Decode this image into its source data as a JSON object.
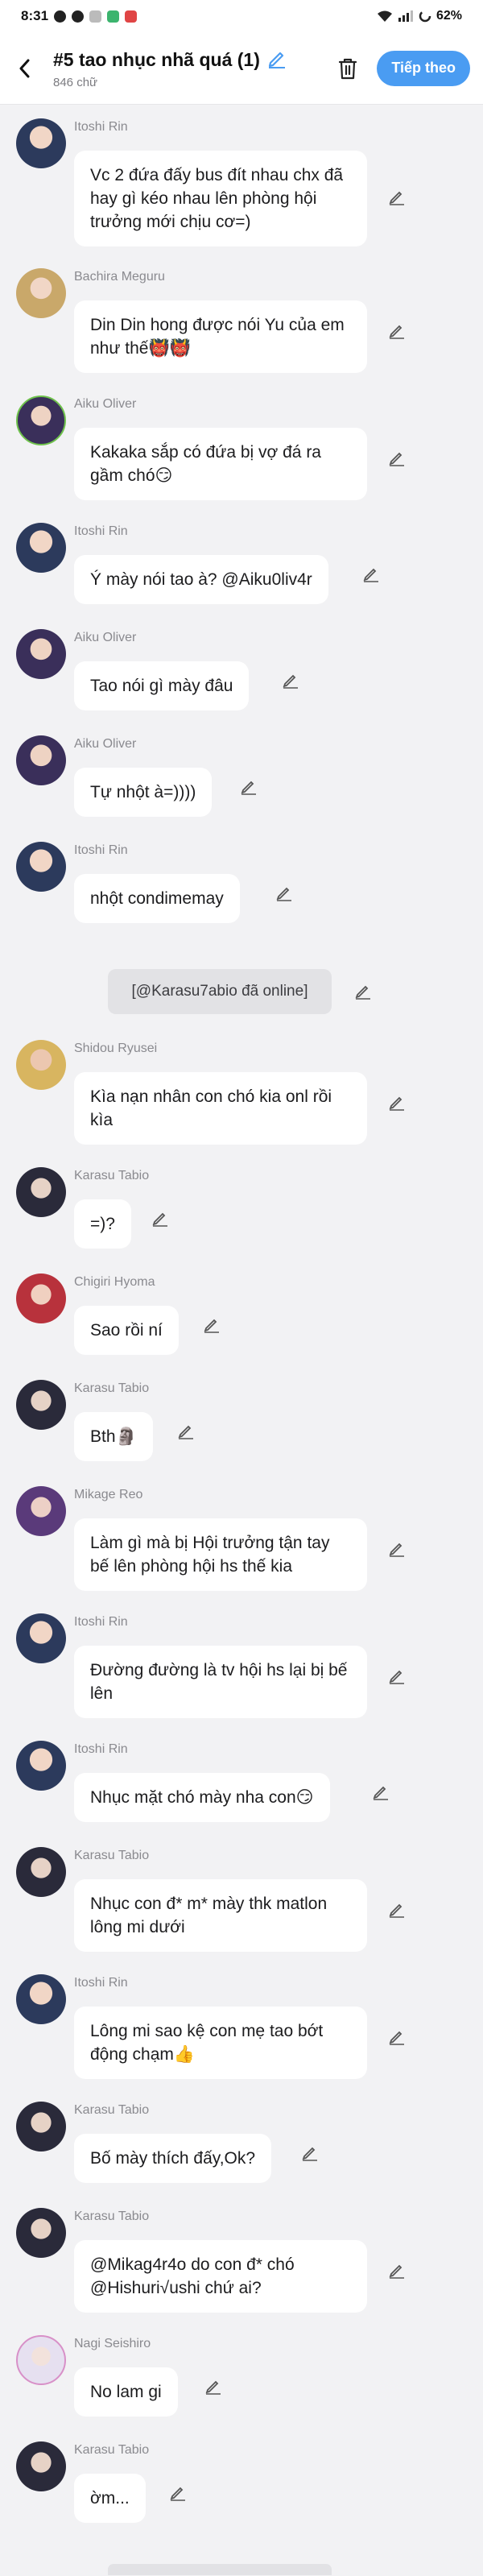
{
  "status": {
    "time": "8:31",
    "battery": "62%"
  },
  "header": {
    "title": "#5 tao nhục nhã quá (1)",
    "subtitle": "846 chữ",
    "follow_label": "Tiếp theo"
  },
  "system_message": "[@Karasu7abio đã online]",
  "messages": [
    {
      "name": "Itoshi Rin",
      "text": "Vc 2 đứa đấy bus đít nhau chx đã hay gì kéo nhau lên phòng hội trưởng mới chịu cơ=)"
    },
    {
      "name": "Bachira Meguru",
      "text": "Din Din hong được nói Yu của em như thế👹👹"
    },
    {
      "name": "Aiku Oliver",
      "text": "Kakaka sắp có đứa bị vợ đá ra gầm chó😏"
    },
    {
      "name": "Itoshi Rin",
      "text": "Ý mày nói tao à? @Aiku0liv4r"
    },
    {
      "name": "Aiku Oliver",
      "text": "Tao nói gì mày đâu"
    },
    {
      "name": "Aiku Oliver",
      "text": "Tự nhột à=))))"
    },
    {
      "name": "Itoshi Rin",
      "text": "nhột condimemay"
    },
    {
      "name": "Shidou Ryusei",
      "text": "Kìa nạn nhân con chó kia onl rồi kìa"
    },
    {
      "name": "Karasu Tabio",
      "text": "=)?"
    },
    {
      "name": "Chigiri Hyoma",
      "text": "Sao rồi ní"
    },
    {
      "name": "Karasu Tabio",
      "text": "Bth🗿"
    },
    {
      "name": "Mikage Reo",
      "text": "Làm gì mà bị Hội trưởng tận tay bế lên phòng hội hs thế kia"
    },
    {
      "name": "Itoshi Rin",
      "text": "Đường đường là tv hội hs lại bị bế lên"
    },
    {
      "name": "Itoshi Rin",
      "text": "Nhục mặt chó mày nha con😏"
    },
    {
      "name": "Karasu Tabio",
      "text": "Nhục con đ* m* mày thk matlon lông mi dưới"
    },
    {
      "name": "Itoshi Rin",
      "text": "Lông mi sao kệ con mẹ tao bớt động chạm👍"
    },
    {
      "name": "Karasu Tabio",
      "text": "Bố mày thích đấy,Ok?"
    },
    {
      "name": "Karasu Tabio",
      "text": "@Mikag4r4o do con đ* chó @Hishuri√ushi chứ ai?"
    },
    {
      "name": "Nagi Seishiro",
      "text": "No lam gi"
    },
    {
      "name": "Karasu Tabio",
      "text": "ờm..."
    }
  ],
  "colors": {
    "accent": "#4a9cf2",
    "background": "#f2f2f4",
    "bubble": "#ffffff",
    "avatar_itoshi": "#2c3a5c",
    "avatar_bachira": "#c9a86a",
    "avatar_aiku": "#3a2f5a",
    "avatar_shidou": "#d8b560",
    "avatar_karasu": "#2a2a3a",
    "avatar_chigiri": "#b8323c",
    "avatar_mikage": "#5a3a7a",
    "avatar_nagi": "#e6e0f0"
  }
}
